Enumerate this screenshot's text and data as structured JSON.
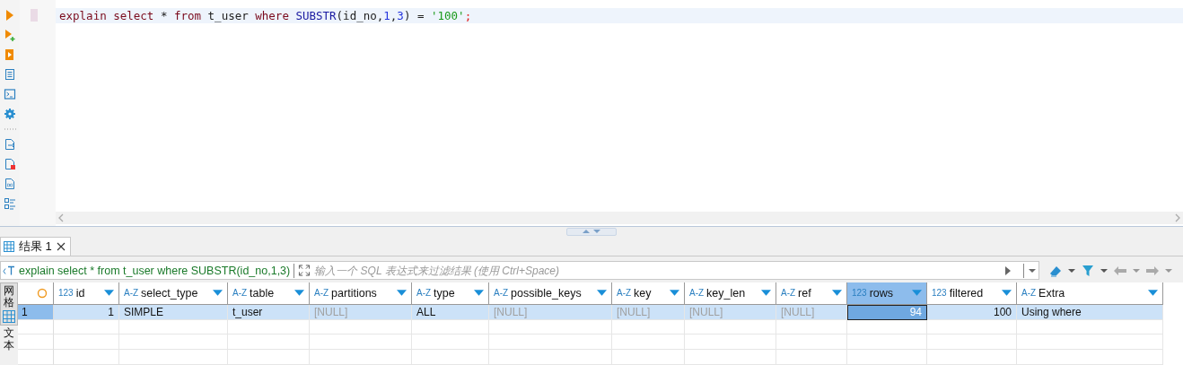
{
  "editor": {
    "code": [
      {
        "text": "explain ",
        "kind": "keyword"
      },
      {
        "text": "select",
        "kind": "keyword"
      },
      {
        "text": " * ",
        "kind": "plain"
      },
      {
        "text": "from",
        "kind": "keyword"
      },
      {
        "text": " t_user ",
        "kind": "plain"
      },
      {
        "text": "where ",
        "kind": "keyword"
      },
      {
        "text": "SUBSTR",
        "kind": "function"
      },
      {
        "text": "(id_no,",
        "kind": "plain"
      },
      {
        "text": "1",
        "kind": "number"
      },
      {
        "text": ",",
        "kind": "plain"
      },
      {
        "text": "3",
        "kind": "number"
      },
      {
        "text": ") = ",
        "kind": "plain"
      },
      {
        "text": "'100'",
        "kind": "string"
      },
      {
        "text": ";",
        "kind": "punct"
      }
    ]
  },
  "results": {
    "tab": {
      "label": "结果 1",
      "selected": true
    },
    "filter": {
      "query": "explain select * from t_user where SUBSTR(id_no,1,3)",
      "placeholder": "输入一个 SQL 表达式来过滤结果 (使用 Ctrl+Space)"
    },
    "view_tabs": [
      {
        "label": "网格",
        "selected": true
      },
      {
        "label": "文本",
        "selected": false
      }
    ],
    "columns": [
      {
        "name": "id",
        "type_label": "123",
        "numeric": true,
        "selected": false
      },
      {
        "name": "select_type",
        "type_label": "A-Z",
        "numeric": false,
        "selected": false
      },
      {
        "name": "table",
        "type_label": "A-Z",
        "numeric": false,
        "selected": false
      },
      {
        "name": "partitions",
        "type_label": "A-Z",
        "numeric": false,
        "selected": false
      },
      {
        "name": "type",
        "type_label": "A-Z",
        "numeric": false,
        "selected": false
      },
      {
        "name": "possible_keys",
        "type_label": "A-Z",
        "numeric": false,
        "selected": false
      },
      {
        "name": "key",
        "type_label": "A-Z",
        "numeric": false,
        "selected": false
      },
      {
        "name": "key_len",
        "type_label": "A-Z",
        "numeric": false,
        "selected": false
      },
      {
        "name": "ref",
        "type_label": "A-Z",
        "numeric": false,
        "selected": false
      },
      {
        "name": "rows",
        "type_label": "123",
        "numeric": true,
        "selected": true
      },
      {
        "name": "filtered",
        "type_label": "123",
        "numeric": true,
        "selected": false
      },
      {
        "name": "Extra",
        "type_label": "A-Z",
        "numeric": false,
        "selected": false
      }
    ],
    "rows": [
      {
        "number": "1",
        "selected": true,
        "cells": [
          {
            "text": "1",
            "null": false
          },
          {
            "text": "SIMPLE",
            "null": false
          },
          {
            "text": "t_user",
            "null": false
          },
          {
            "text": "[NULL]",
            "null": true
          },
          {
            "text": "ALL",
            "null": false
          },
          {
            "text": "[NULL]",
            "null": true
          },
          {
            "text": "[NULL]",
            "null": true
          },
          {
            "text": "[NULL]",
            "null": true
          },
          {
            "text": "[NULL]",
            "null": true
          },
          {
            "text": "94",
            "null": false
          },
          {
            "text": "100",
            "null": false
          },
          {
            "text": "Using where",
            "null": false
          }
        ]
      }
    ]
  }
}
